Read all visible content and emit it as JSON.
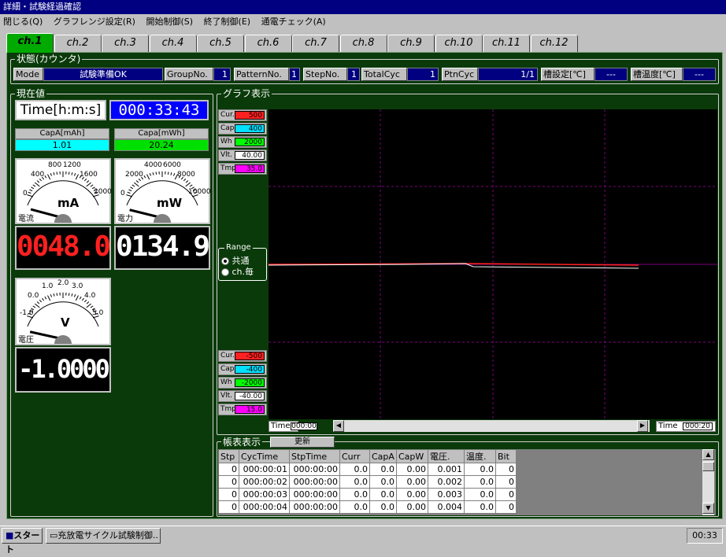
{
  "window": {
    "title": "詳細・試験経過確認"
  },
  "menu": [
    "閉じる(Q)",
    "グラフレンジ設定(R)",
    "開始制御(S)",
    "終了制御(E)",
    "通電チェック(A)"
  ],
  "tabs": [
    "ch.1",
    "ch.2",
    "ch.3",
    "ch.4",
    "ch.5",
    "ch.6",
    "ch.7",
    "ch.8",
    "ch.9",
    "ch.10",
    "ch.11",
    "ch.12"
  ],
  "active_tab": 0,
  "status": {
    "title": "状態(カウンタ)",
    "mode_label": "Mode",
    "mode_value": "試験準備OK",
    "group_label": "GroupNo.",
    "group_value": "1",
    "pattern_label": "PatternNo.",
    "pattern_value": "1",
    "step_label": "StepNo.",
    "step_value": "1",
    "totalcyc_label": "TotalCyc",
    "totalcyc_value": "1",
    "ptncyc_label": "PtnCyc",
    "ptncyc_value": "1/1",
    "tank_set_label": "槽設定[℃]",
    "tank_set_value": "---",
    "tank_temp_label": "槽温度[℃]",
    "tank_temp_value": "---"
  },
  "current": {
    "title": "現在値",
    "time_label": "Time[h:m:s]",
    "time_value": "000:33:43",
    "capa_mah_label": "CapA[mAh]",
    "capa_mah_value": "1.01",
    "capa_mwh_label": "Capa[mWh]",
    "capa_mwh_value": "20.24",
    "meter_current": {
      "unit": "mA",
      "name": "電流",
      "scale": [
        "0",
        "400",
        "800",
        "1200",
        "1600",
        "2000"
      ],
      "lcd": "0048.0",
      "value": 48.0,
      "max": 2000
    },
    "meter_power": {
      "unit": "mW",
      "name": "電力",
      "scale": [
        "0",
        "2000",
        "4000",
        "6000",
        "8000",
        "10000"
      ],
      "lcd": "0134.9",
      "value": 134.9,
      "max": 10000
    },
    "meter_voltage": {
      "unit": "V",
      "name": "電圧",
      "scale": [
        "-1.0",
        "0.0",
        "1.0",
        "2.0",
        "3.0",
        "4.0",
        "5.0"
      ],
      "lcd": "-1.0000",
      "value": -1.0,
      "min": -1.0,
      "max": 5.0
    }
  },
  "graph": {
    "title": "グラフ表示",
    "top_labels": [
      {
        "name": "Cur.",
        "value": "500",
        "color": "#ff2020"
      },
      {
        "name": "Cap",
        "value": "400",
        "color": "#00e0ff"
      },
      {
        "name": "Wh",
        "value": "2000",
        "color": "#00ff00"
      },
      {
        "name": "Vlt.",
        "value": "40.00",
        "color": "#ffffff"
      },
      {
        "name": "Tmp.",
        "value": "35.0",
        "color": "#ff00ff"
      }
    ],
    "bottom_labels": [
      {
        "name": "Cur.",
        "value": "-500",
        "color": "#ff2020"
      },
      {
        "name": "Cap",
        "value": "-400",
        "color": "#00e0ff"
      },
      {
        "name": "Wh",
        "value": "-2000",
        "color": "#00ff00"
      },
      {
        "name": "Vlt.",
        "value": "-40.00",
        "color": "#ffffff"
      },
      {
        "name": "Tmp.",
        "value": "15.0",
        "color": "#ff00ff"
      }
    ],
    "range_title": "Range",
    "range_common": "共通",
    "range_each": "ch.毎",
    "time_label": "Time",
    "time_start": "000:00",
    "time_end": "000:20"
  },
  "table": {
    "title": "帳表表示",
    "refresh": "更新",
    "columns": [
      "Stp",
      "CycTime",
      "StpTime",
      "Curr",
      "CapA",
      "CapW",
      "電圧.",
      "温度.",
      "Bit"
    ],
    "rows": [
      [
        "0",
        "000:00:01",
        "000:00:00",
        "0.0",
        "0.0",
        "0.00",
        "0.001",
        "0.0",
        "0"
      ],
      [
        "0",
        "000:00:02",
        "000:00:00",
        "0.0",
        "0.0",
        "0.00",
        "0.002",
        "0.0",
        "0"
      ],
      [
        "0",
        "000:00:03",
        "000:00:00",
        "0.0",
        "0.0",
        "0.00",
        "0.003",
        "0.0",
        "0"
      ],
      [
        "0",
        "000:00:04",
        "000:00:00",
        "0.0",
        "0.0",
        "0.00",
        "0.004",
        "0.0",
        "0"
      ]
    ]
  },
  "taskbar": {
    "start": "スタート",
    "task": "充放電サイクル試験制御..",
    "clock": "00:33"
  }
}
